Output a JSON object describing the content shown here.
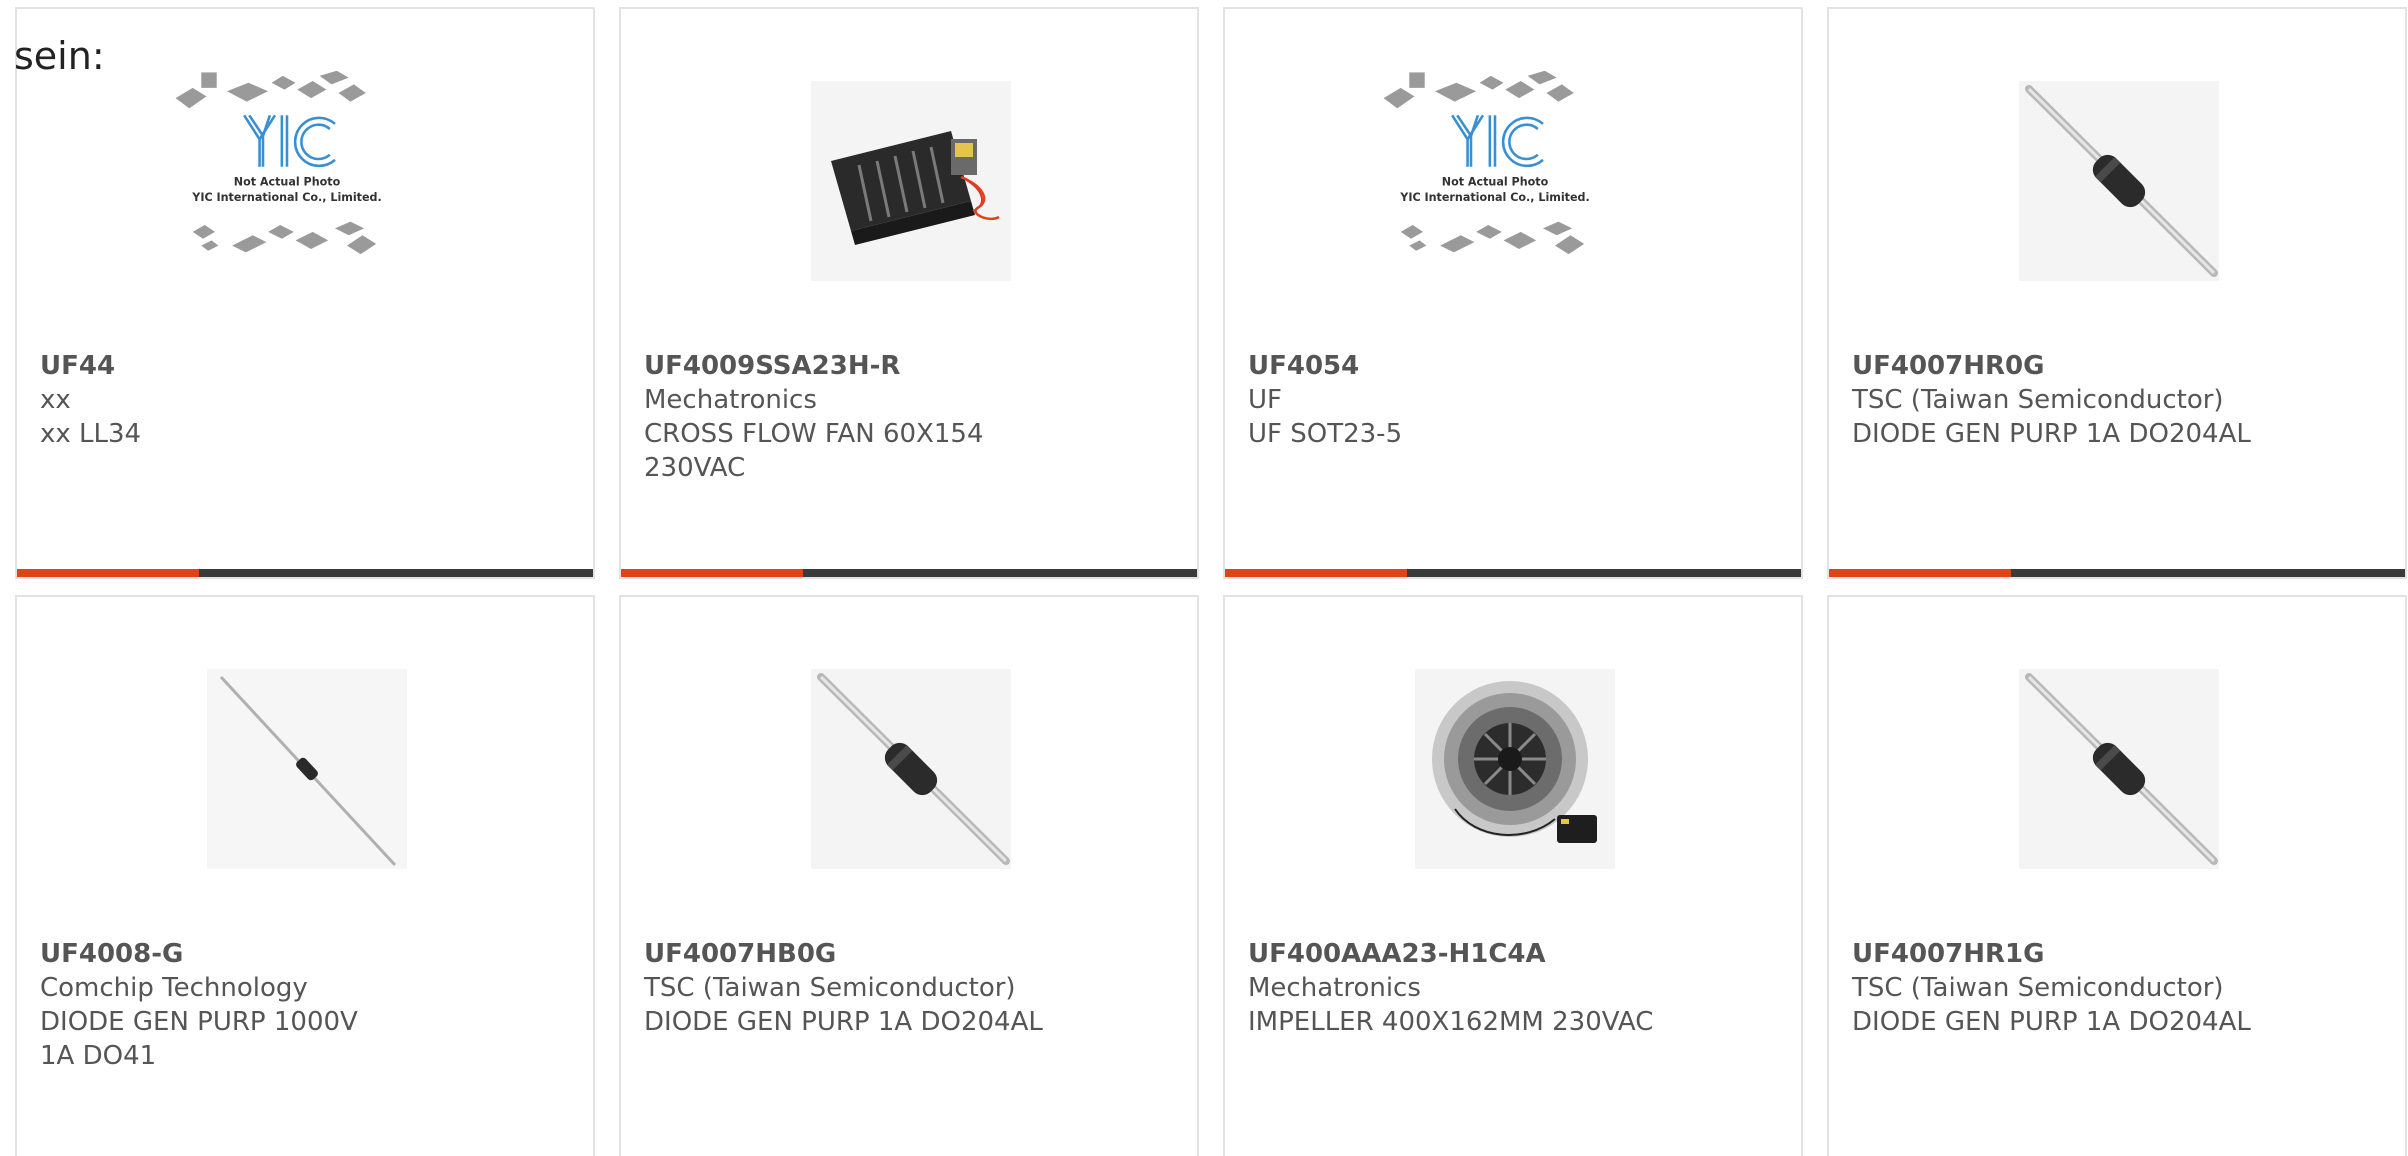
{
  "intro_text": "sein:",
  "placeholder": {
    "line1": "Not Actual Photo",
    "line2": "YIC International Co., Limited.",
    "logo": "YIC"
  },
  "colors": {
    "accent": "#e2421a",
    "bar": "#3a3a3a",
    "text": "#555555",
    "border": "#e2e2e2"
  },
  "products": [
    {
      "part": "UF44",
      "maker": "xx",
      "desc": "xx LL34",
      "image": "yic-placeholder"
    },
    {
      "part": "UF4009SSA23H-R",
      "maker": "Mechatronics",
      "desc": "CROSS FLOW FAN 60X154 230VAC",
      "image": "cross-flow-fan"
    },
    {
      "part": "UF4054",
      "maker": "UF",
      "desc": "UF SOT23-5",
      "image": "yic-placeholder"
    },
    {
      "part": "UF4007HR0G",
      "maker": "TSC (Taiwan Semiconductor)",
      "desc": "DIODE GEN PURP 1A DO204AL",
      "image": "axial-diode"
    },
    {
      "part": "UF4008-G",
      "maker": "Comchip Technology",
      "desc": "DIODE GEN PURP 1000V 1A DO41",
      "image": "thin-axial-diode"
    },
    {
      "part": "UF4007HB0G",
      "maker": "TSC (Taiwan Semiconductor)",
      "desc": "DIODE GEN PURP 1A DO204AL",
      "image": "axial-diode"
    },
    {
      "part": "UF400AAA23-H1C4A",
      "maker": "Mechatronics",
      "desc": "IMPELLER 400X162MM 230VAC",
      "image": "impeller"
    },
    {
      "part": "UF4007HR1G",
      "maker": "TSC (Taiwan Semiconductor)",
      "desc": "DIODE GEN PURP 1A DO204AL",
      "image": "axial-diode"
    }
  ]
}
